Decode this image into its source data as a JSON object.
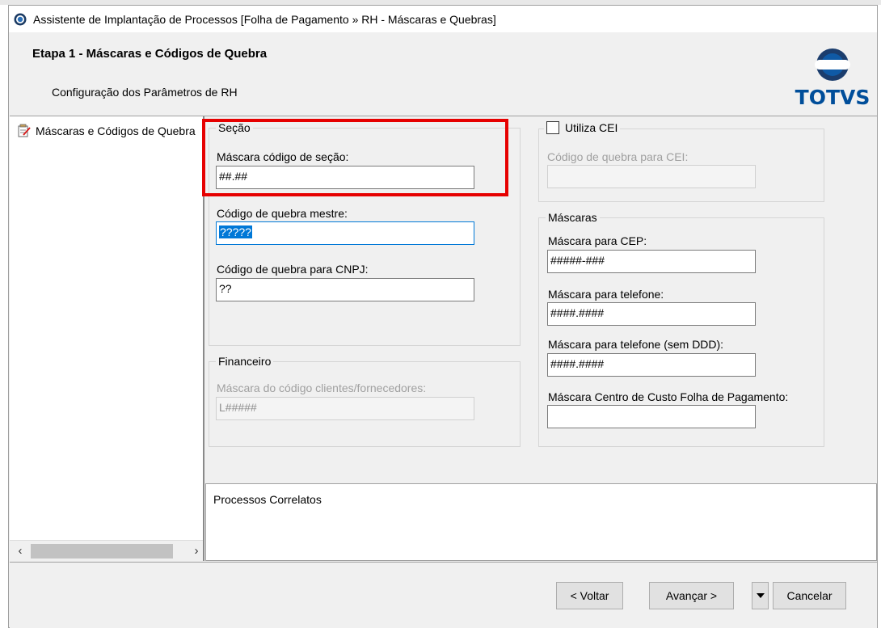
{
  "window": {
    "title": "Assistente de Implantação de Processos [Folha de Pagamento » RH - Máscaras e Quebras]"
  },
  "header": {
    "step_title": "Etapa 1 - Máscaras e Códigos de Quebra",
    "step_subtitle": "Configuração dos Parâmetros de RH",
    "logo_text": "TOTVS"
  },
  "tree": {
    "items": [
      {
        "label": "Máscaras e Códigos de Quebra"
      }
    ]
  },
  "secao": {
    "legend": "Seção",
    "mascara_label": "Máscara código de seção:",
    "mascara_value": "##.##",
    "quebra_mestre_label": "Código de quebra mestre:",
    "quebra_mestre_value": "?????",
    "quebra_cnpj_label": "Código de quebra para CNPJ:",
    "quebra_cnpj_value": "??"
  },
  "financeiro": {
    "legend": "Financeiro",
    "mascara_label": "Máscara do código clientes/fornecedores:",
    "mascara_value": "L#####"
  },
  "cei": {
    "checkbox_label": "Utiliza CEI",
    "checked": false,
    "quebra_label": "Código de quebra para CEI:",
    "quebra_value": ""
  },
  "mascaras": {
    "legend": "Máscaras",
    "cep_label": "Máscara para CEP:",
    "cep_value": "#####-###",
    "telefone_label": "Máscara para telefone:",
    "telefone_value": "####.####",
    "telefone_sem_ddd_label": "Máscara para telefone (sem DDD):",
    "telefone_sem_ddd_value": "####.####",
    "centro_custo_label": "Máscara Centro de Custo Folha de Pagamento:",
    "centro_custo_value": ""
  },
  "related": {
    "title": "Processos Correlatos"
  },
  "footer": {
    "back_label": "< Voltar",
    "next_label": "Avançar >",
    "cancel_label": "Cancelar"
  },
  "colors": {
    "highlight": "#e60000",
    "focus": "#0078d7",
    "logo": "#004e9a"
  }
}
